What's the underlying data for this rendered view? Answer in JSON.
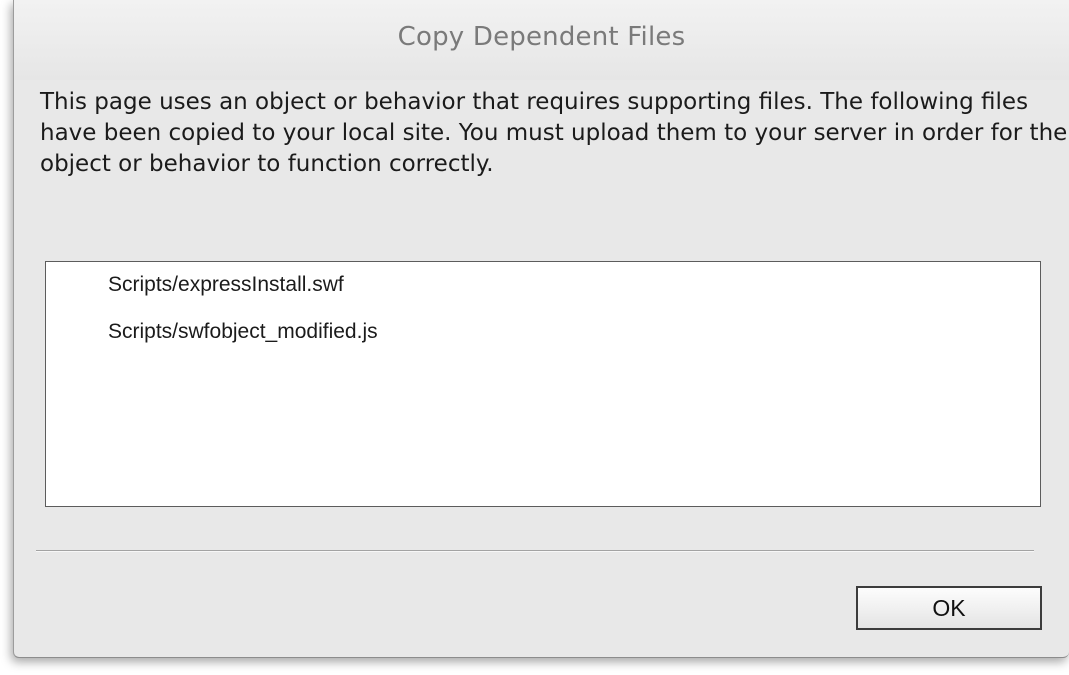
{
  "dialog": {
    "title": "Copy Dependent Files",
    "message": "This page uses an object or behavior that requires supporting files. The following files have been copied to your local site. You must upload them to your server in order for the object or behavior to function correctly.",
    "files": [
      "Scripts/expressInstall.swf",
      "Scripts/swfobject_modified.js"
    ],
    "ok_label": "OK"
  }
}
